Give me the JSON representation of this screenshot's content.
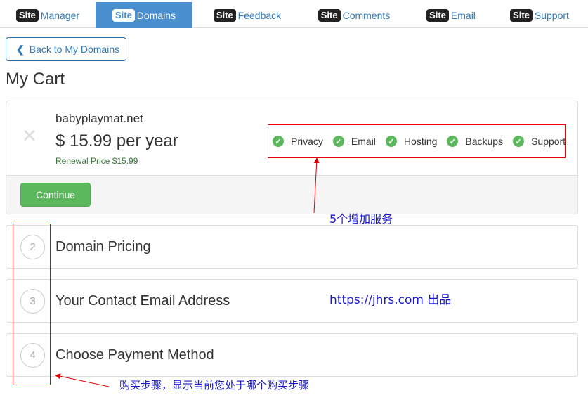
{
  "tabs": [
    {
      "badge": "Site",
      "label": "Manager",
      "active": false
    },
    {
      "badge": "Site",
      "label": "Domains",
      "active": true
    },
    {
      "badge": "Site",
      "label": "Feedback",
      "active": false
    },
    {
      "badge": "Site",
      "label": "Comments",
      "active": false
    },
    {
      "badge": "Site",
      "label": "Email",
      "active": false
    },
    {
      "badge": "Site",
      "label": "Support",
      "active": false
    }
  ],
  "back_button": {
    "label": "Back to My Domains",
    "icon": "chevron-left-icon"
  },
  "page_title": "My Cart",
  "cart": {
    "remove_icon": "close-icon",
    "domain": "babyplaymat.net",
    "price": "$ 15.99 per year",
    "renewal": "Renewal Price $15.99",
    "features": [
      "Privacy",
      "Email",
      "Hosting",
      "Backups",
      "Support"
    ],
    "continue_label": "Continue"
  },
  "steps": [
    {
      "number": "2",
      "title": "Domain Pricing"
    },
    {
      "number": "3",
      "title": "Your Contact Email Address"
    },
    {
      "number": "4",
      "title": "Choose Payment Method"
    }
  ],
  "annotations": {
    "services": "5个增加服务",
    "site": "https://jhrs.com 出品",
    "steps": "购买步骤，显示当前您处于哪个购买步骤"
  },
  "colors": {
    "active_tab": "#4a8fcf",
    "link": "#337ab7",
    "success": "#5cb85c",
    "annotation_red": "#dd0000",
    "annotation_blue": "#1a1acc"
  }
}
